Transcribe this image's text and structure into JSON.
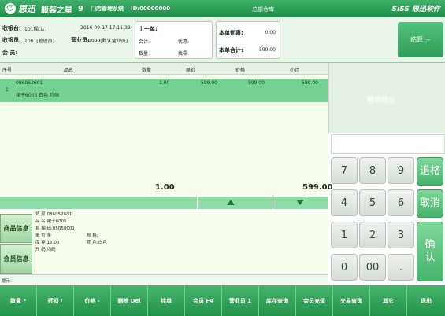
{
  "titlebar": {
    "brand": "思迅",
    "product": "服装之星",
    "version": "9",
    "system_name": "门店管理系统",
    "device_id": "ID:00000000",
    "store": "总部仓库",
    "vendor": "SiSS 思迅软件"
  },
  "info": {
    "register_label": "收银台:",
    "register_value": "101[默认]",
    "datetime": "2016-09-17 17:11:39",
    "cashier_label": "收银员:",
    "cashier_value": "1001[管理员]",
    "sales_label": "营业员:",
    "sales_value": "9999[默认营业员]",
    "member_label": "会  员:",
    "last_order": {
      "title": "上一单:",
      "total_label": "合计:",
      "discount_label": "优惠:",
      "qty_label": "数量:",
      "change_label": "找零:"
    },
    "current": {
      "discount_label": "本单优惠:",
      "discount_value": "0.00",
      "total_label": "本单合计:",
      "total_value": "599.00"
    },
    "checkout_label": "结算",
    "checkout_key": "+"
  },
  "table": {
    "headers": [
      "序号",
      "品名",
      "数量",
      "原价",
      "价格",
      "小计"
    ],
    "rows": [
      {
        "no": "1",
        "code": "086052601",
        "desc": "裙子6005 白色 均码",
        "qty": "1.00",
        "orig": "599.00",
        "price": "599.00",
        "subtotal": "599.00"
      }
    ],
    "total_qty": "1.00",
    "total_amount": "599.00"
  },
  "detail": {
    "tab_product": "商品信息",
    "tab_member": "会员信息",
    "code": "货    号:086052601",
    "name": "品    名:裙子6005",
    "self_code": "自 编 码:05050001",
    "unit": "单    位:条",
    "spec": "规    格:",
    "stock": "库    存:16.00",
    "color": "花    色:白色",
    "size": "尺    码:均码",
    "hint": "提示:"
  },
  "right": {
    "bestsellers": "畅销商品"
  },
  "keypad": {
    "keys": [
      "7",
      "8",
      "9",
      "4",
      "5",
      "6",
      "1",
      "2",
      "3",
      "0",
      "00",
      "."
    ],
    "return_label": "退格",
    "cancel_label": "取消",
    "confirm_label": "确认"
  },
  "toolbar": [
    "数量 *",
    "折扣 /",
    "价格 -",
    "删除 Del",
    "挂单",
    "会员 F4",
    "营业员 1",
    "库存查询",
    "会员充值",
    "交易查询",
    "其它",
    "退出"
  ]
}
